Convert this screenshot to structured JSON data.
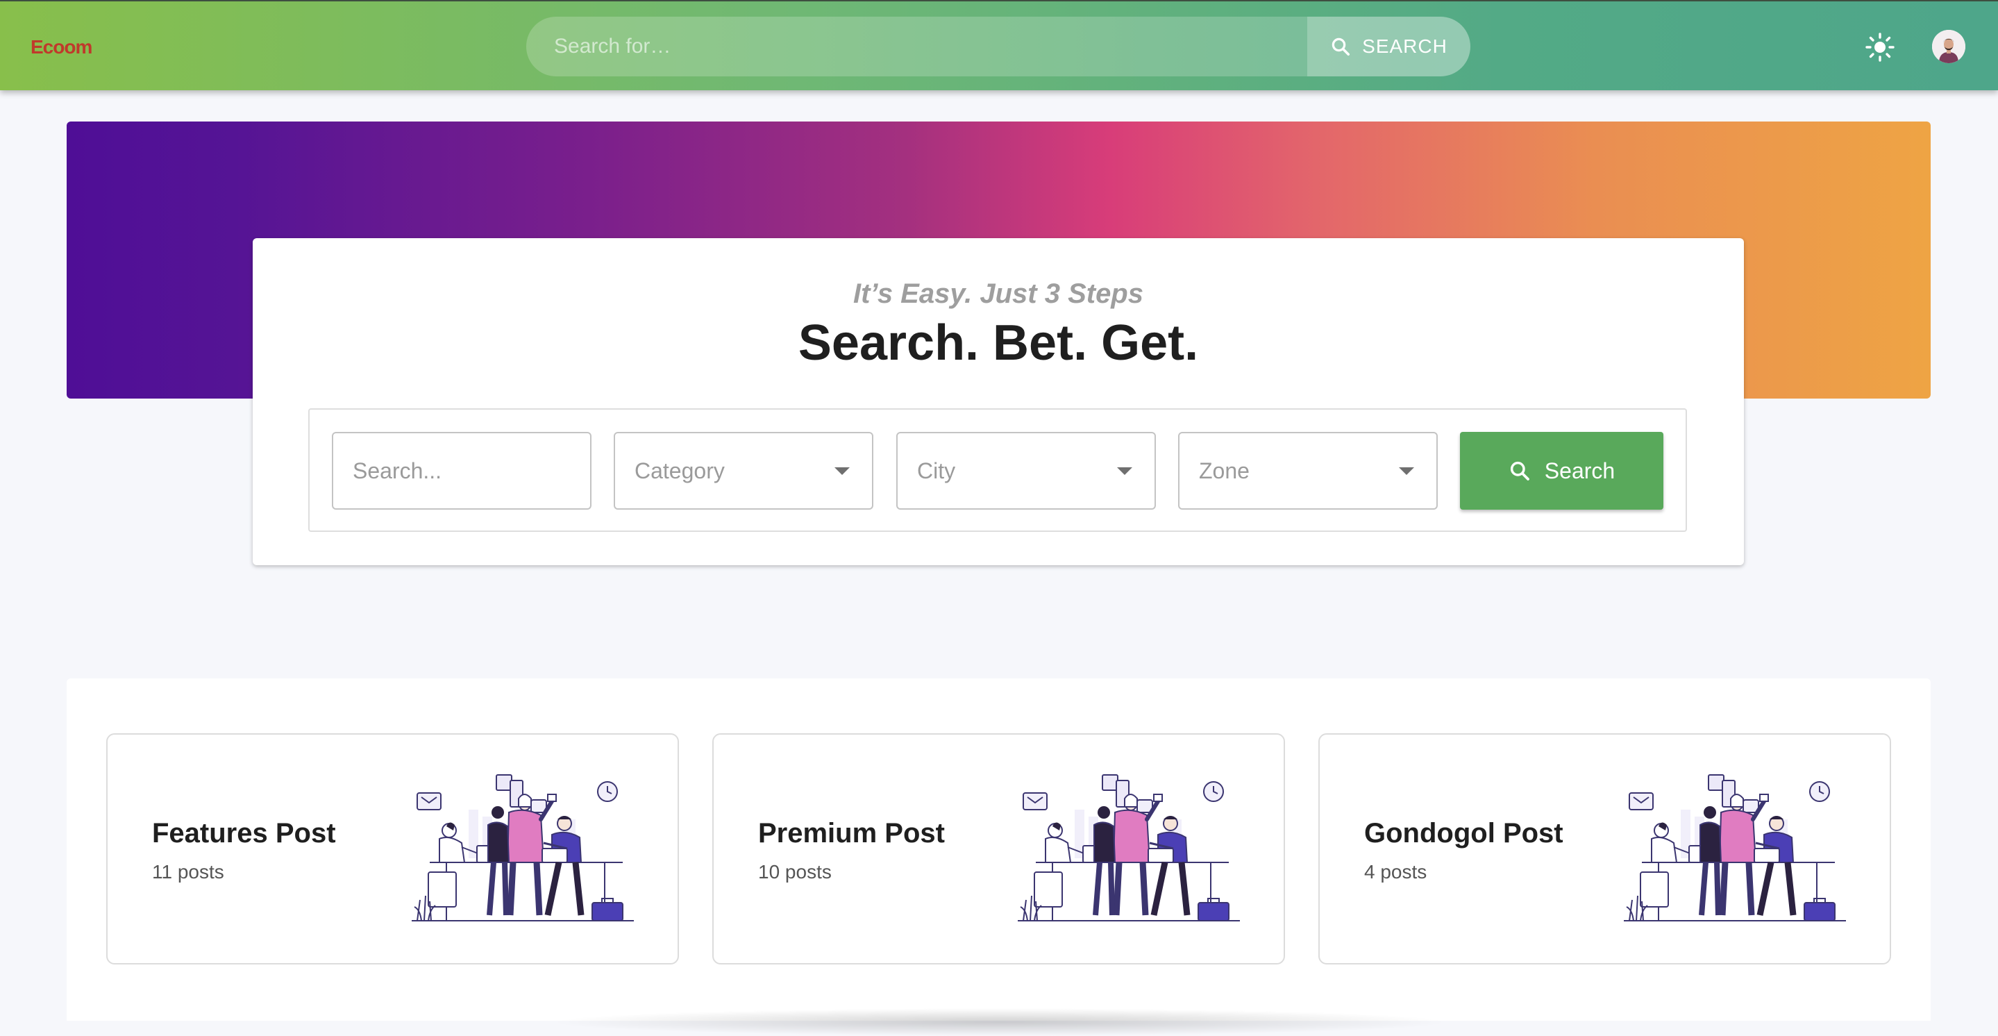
{
  "app": {
    "logo_text": "Ecoom"
  },
  "topbar": {
    "search_placeholder": "Search for…",
    "search_button_label": "SEARCH",
    "theme_toggle_icon": "sun-icon",
    "avatar_icon": "user-avatar"
  },
  "hero": {
    "subtitle": "It’s Easy. Just 3 Steps",
    "title": "Search. Bet. Get.",
    "filters": {
      "search_placeholder": "Search...",
      "category_label": "Category",
      "city_label": "City",
      "zone_label": "Zone",
      "search_button_label": "Search"
    }
  },
  "posts": {
    "cards": [
      {
        "title": "Features Post",
        "count": "11 posts"
      },
      {
        "title": "Premium Post",
        "count": "10 posts"
      },
      {
        "title": "Gondogol Post",
        "count": "4 posts"
      }
    ]
  },
  "colors": {
    "header_gradient_start": "#88bf4b",
    "header_gradient_end": "#4ea68a",
    "banner_gradient_start": "#4f0e96",
    "banner_gradient_mid": "#d83d79",
    "banner_gradient_end": "#eea444",
    "search_button": "#59a95b",
    "illustration_accent": "#4b3fb5",
    "illustration_pink": "#e07cc1"
  }
}
